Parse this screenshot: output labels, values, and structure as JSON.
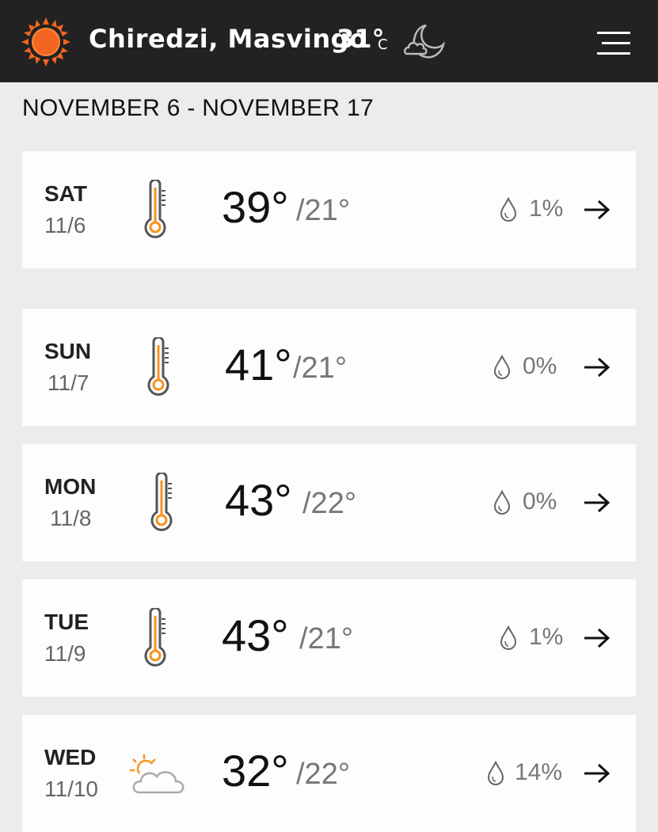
{
  "header": {
    "location": "Chiredzi, Masvingo",
    "current_temp": "31°",
    "unit": "C",
    "icon": "sun-icon",
    "condition_icon": "moon-cloud-icon",
    "menu_icon": "hamburger-menu-icon",
    "accent_color": "#ff6a00"
  },
  "date_range": "NOVEMBER 6 - NOVEMBER 17",
  "days": [
    {
      "day": "SAT",
      "date": "11/6",
      "high": "39°",
      "low": "/21°",
      "precip": "1%",
      "icon": "thermometer-icon"
    },
    {
      "day": "SUN",
      "date": "11/7",
      "high": "41°",
      "low": "/21°",
      "precip": "0%",
      "icon": "thermometer-icon"
    },
    {
      "day": "MON",
      "date": "11/8",
      "high": "43°",
      "low": "/22°",
      "precip": "0%",
      "icon": "thermometer-icon"
    },
    {
      "day": "TUE",
      "date": "11/9",
      "high": "43°",
      "low": "/21°",
      "precip": "1%",
      "icon": "thermometer-icon"
    },
    {
      "day": "WED",
      "date": "11/10",
      "high": "32°",
      "low": "/22°",
      "precip": "14%",
      "icon": "partly-cloudy-icon"
    }
  ]
}
